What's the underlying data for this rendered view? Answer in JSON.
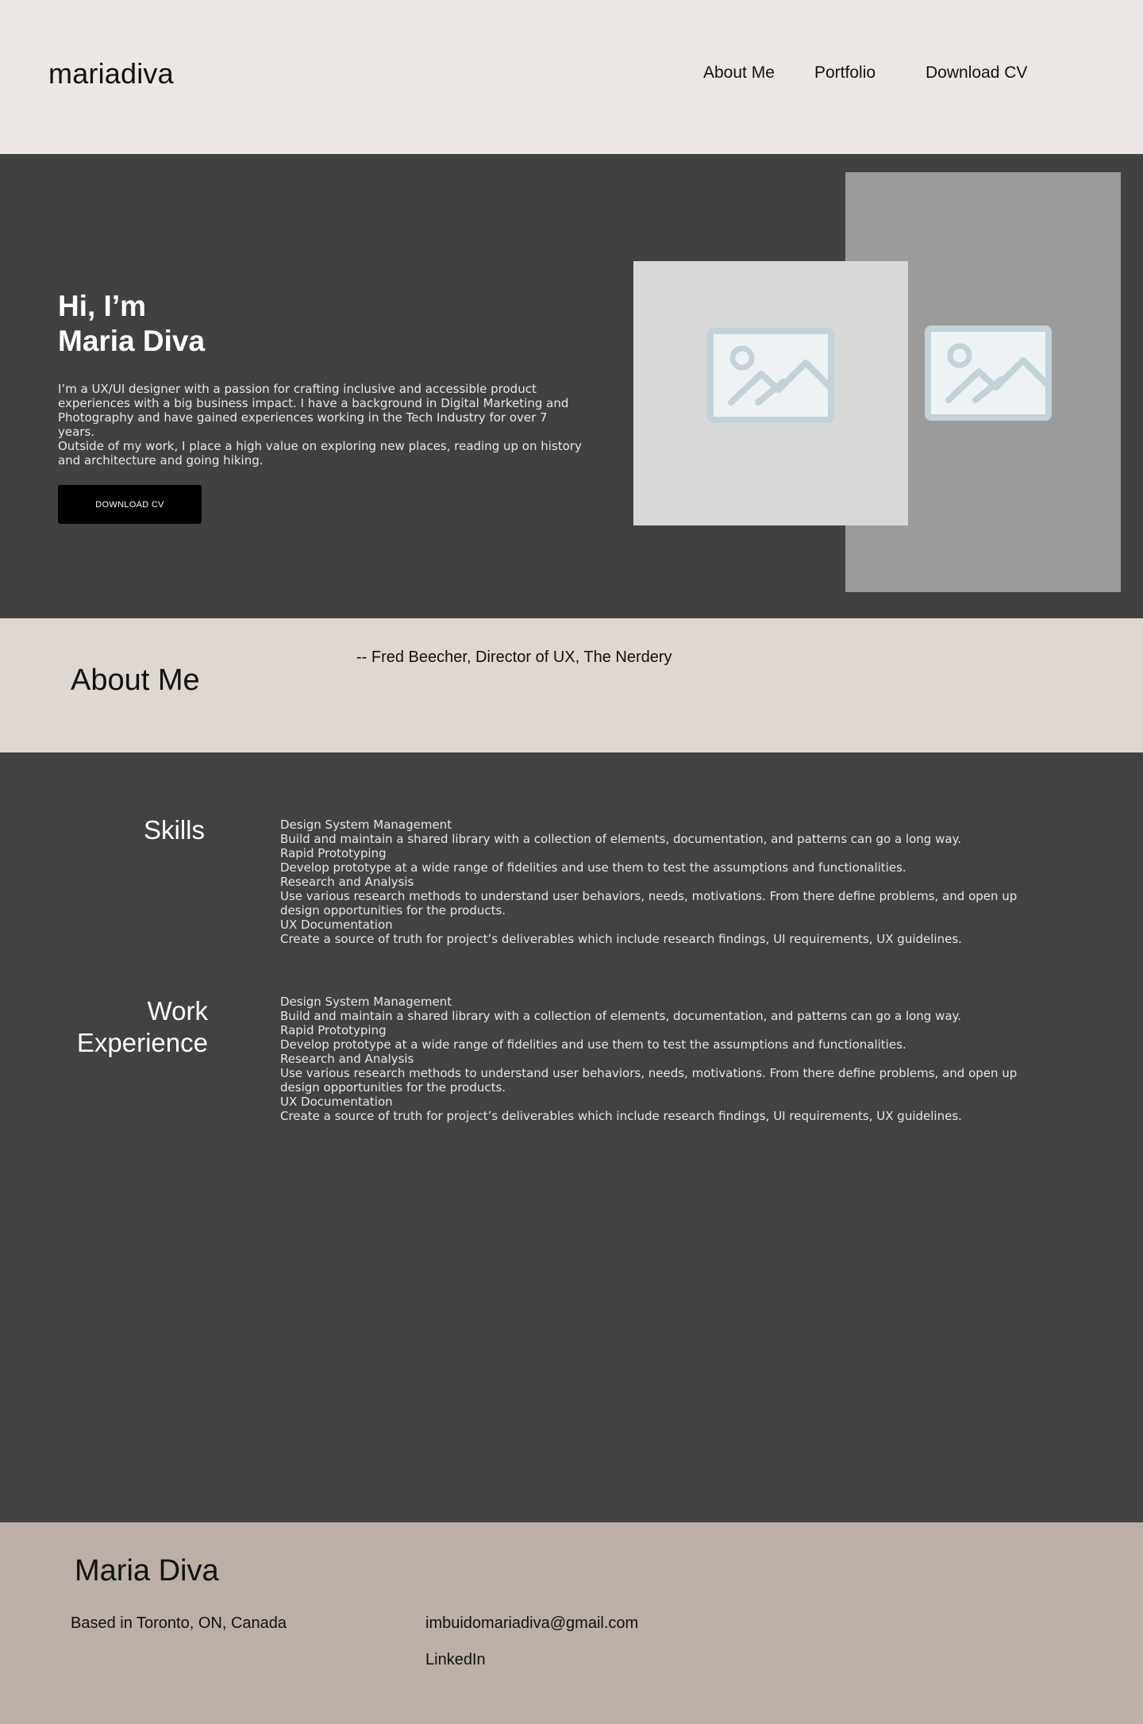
{
  "header": {
    "logo": "mariadiva",
    "nav": [
      "About Me",
      "Portfolio",
      "Download CV"
    ]
  },
  "hero": {
    "heading_line1": "Hi, I’m",
    "heading_line2": "Maria Diva",
    "para1": "I’m a UX/UI designer with a passion for crafting inclusive and accessible product experiences with a big business impact. I have a background in Digital Marketing and Photography and have gained experiences working in the Tech Industry for over 7 years.",
    "para2": "Outside of my work, I place a high value on exploring new places, reading up on history and architecture and going hiking.",
    "button": "DOWNLOAD CV"
  },
  "about": {
    "title": "About Me",
    "quote": "-- Fred Beecher, Director of UX, The Nerdery"
  },
  "skills": {
    "title": "Skills",
    "items": [
      "Design System Management",
      "Build and maintain a shared library with a collection of elements, documentation, and patterns can go a long way.",
      "Rapid Prototyping",
      "Develop prototype at a wide range of fidelities and use them to test the assumptions and functionalities.",
      "Research and Analysis",
      "Use various research methods to understand user behaviors, needs, motivations. From there define problems, and open up design opportunities for the products.",
      "UX Documentation",
      "Create a source of truth for project’s deliverables which include research findings, UI requirements, UX guidelines."
    ]
  },
  "work": {
    "title_line1": "Work",
    "title_line2": "Experience",
    "items": [
      "Design System Management",
      "Build and maintain a shared library with a collection of elements, documentation, and patterns can go a long way.",
      "Rapid Prototyping",
      "Develop prototype at a wide range of fidelities and use them to test the assumptions and functionalities.",
      "Research and Analysis",
      "Use various research methods to understand user behaviors, needs, motivations. From there define problems, and open up design opportunities for the products.",
      "UX Documentation",
      "Create a source of truth for project’s deliverables which include research findings, UI requirements, UX guidelines."
    ]
  },
  "footer": {
    "name": "Maria Diva",
    "location": "Based in Toronto, ON, Canada",
    "email": "imbuidomariadiva@gmail.com",
    "linkedin": "LinkedIn"
  },
  "icons": {
    "image_placeholder": "image-placeholder-icon"
  },
  "colors": {
    "header_bg": "#ece7e4",
    "hero_bg": "#414141",
    "about_bg": "#dfd7d1",
    "content_bg": "#424242",
    "footer_bg": "#bbafa7",
    "button_bg": "#000000"
  }
}
